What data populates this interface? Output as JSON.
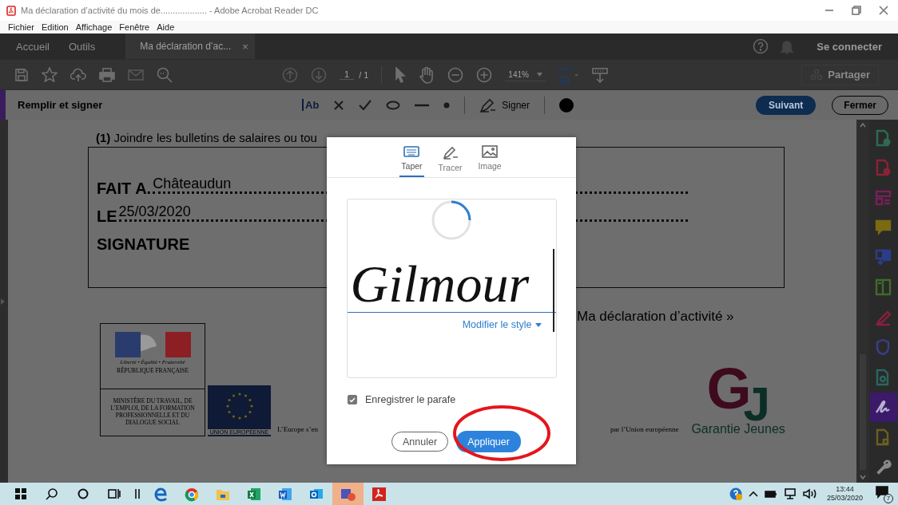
{
  "window": {
    "title": "Ma déclaration d’activité du mois de................... - Adobe Acrobat Reader DC"
  },
  "menu": [
    "Fichier",
    "Edition",
    "Affichage",
    "Fenêtre",
    "Aide"
  ],
  "tabs": [
    {
      "label": "Accueil",
      "selected": false
    },
    {
      "label": "Outils",
      "selected": false
    },
    {
      "label": "Ma déclaration d’ac...",
      "selected": true,
      "close": "×"
    }
  ],
  "account": "Se connecter",
  "toolbar": {
    "page": "1",
    "page_count": "/ 1",
    "zoom": "141%",
    "share": "Partager"
  },
  "fill_sign": {
    "title": "Remplir et signer",
    "text_tool": "Ab",
    "sign": "Signer",
    "next": "Suivant",
    "close": "Fermer"
  },
  "document": {
    "footnote": "**(1)** Joindre les bulletins de salaires ou tou",
    "fields": [
      {
        "label": "FAIT A.",
        "value": "Châteaudun"
      },
      {
        "label": "LE",
        "value": "25/03/2020"
      }
    ],
    "signature_label": "SIGNATURE",
    "quote": "Ma déclaration d’activité »",
    "rf_logo": {
      "motto": "Liberté • Égalité • Fraternité",
      "name": "RÉPUBLIQUE FRANÇAISE",
      "ministry": "MINISTÈRE DU TRAVAIL, DE L’EMPLOI, DE LA FORMATION PROFESSIONNELLE ET DU DIALOGUE SOCIAL"
    },
    "eu_label": "UNION EUROPÉENNE",
    "eu_text_left": "L’Europe s’en",
    "eu_text_right": "par l’Union européenne",
    "gj_logo": {
      "letters": [
        "G",
        "J"
      ],
      "name": "Garantie Jeunes"
    }
  },
  "dialog": {
    "tabs": [
      {
        "label": "Taper",
        "kind": "keyboard",
        "selected": true
      },
      {
        "label": "Tracer",
        "kind": "pen",
        "selected": false
      },
      {
        "label": "Image",
        "kind": "image",
        "selected": false
      }
    ],
    "loading": true,
    "signature": "Gilmour",
    "style_link": "Modifier le style",
    "save_initials": {
      "label": "Enregistrer le parafe",
      "checked": true
    },
    "buttons": [
      {
        "label": "Annuler",
        "kind": "secondary"
      },
      {
        "label": "Appliquer",
        "kind": "primary"
      }
    ]
  },
  "sidebar": [
    {
      "kind": "doc-arrow",
      "color": "#2d6b52",
      "selected": false
    },
    {
      "kind": "doc-plus",
      "color": "#8a2236",
      "selected": false
    },
    {
      "kind": "layout",
      "color": "#7a1f5a",
      "selected": false
    },
    {
      "kind": "comment",
      "color": "#7a6a12",
      "selected": false
    },
    {
      "kind": "doc-down",
      "color": "#2c3c8c",
      "selected": false
    },
    {
      "kind": "columns",
      "color": "#3f6b2c",
      "selected": false
    },
    {
      "kind": "pen",
      "color": "#8a1f3c",
      "selected": false
    },
    {
      "kind": "shield",
      "color": "#3a3e8a",
      "selected": false
    },
    {
      "kind": "doc-gear",
      "color": "#2a6660",
      "selected": false
    },
    {
      "kind": "sign",
      "color": "#b8b0d0",
      "selected": true
    },
    {
      "kind": "doc",
      "color": "#6b6020",
      "selected": false
    },
    {
      "kind": "wrench",
      "color": "#8a8a8a",
      "selected": false
    }
  ],
  "taskbar": {
    "apps": [
      {
        "kind": "browser",
        "selected": false
      },
      {
        "kind": "globe",
        "selected": false
      },
      {
        "kind": "folder",
        "selected": false
      },
      {
        "kind": "sheet",
        "selected": false
      },
      {
        "kind": "word",
        "selected": false
      },
      {
        "kind": "mail",
        "selected": false
      },
      {
        "kind": "chat",
        "selected": true
      },
      {
        "kind": "pdf",
        "selected": false
      }
    ],
    "time": "13:44",
    "date": "25/03/2020",
    "notifications": "7"
  }
}
